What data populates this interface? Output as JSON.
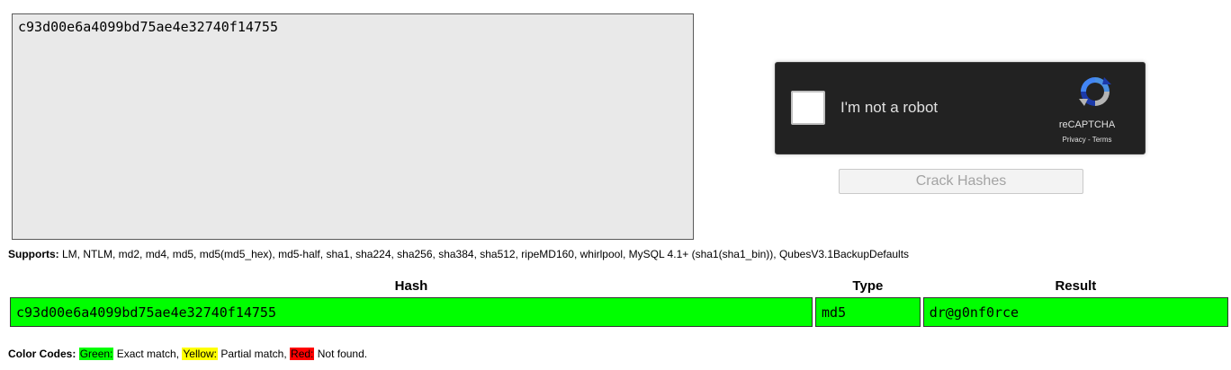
{
  "hash_input": {
    "value": "c93d00e6a4099bd75ae4e32740f14755"
  },
  "recaptcha": {
    "label": "I'm not a robot",
    "brand": "reCAPTCHA",
    "links": "Privacy - Terms"
  },
  "crack_button": {
    "label": "Crack Hashes"
  },
  "supports": {
    "label": "Supports:",
    "text": " LM, NTLM, md2, md4, md5, md5(md5_hex), md5-half, sha1, sha224, sha256, sha384, sha512, ripeMD160, whirlpool, MySQL 4.1+ (sha1(sha1_bin)), QubesV3.1BackupDefaults"
  },
  "results_table": {
    "headers": [
      "Hash",
      "Type",
      "Result"
    ],
    "rows": [
      {
        "hash": "c93d00e6a4099bd75ae4e32740f14755",
        "type": "md5",
        "result": "dr@g0nf0rce",
        "status": "exact"
      }
    ]
  },
  "color_codes": {
    "label": "Color Codes:",
    "green": {
      "name": "Green:",
      "desc": " Exact match, ",
      "color": "#00ff00"
    },
    "yellow": {
      "name": "Yellow:",
      "desc": " Partial match, ",
      "color": "#ffff00"
    },
    "red": {
      "name": "Red:",
      "desc": " Not found.",
      "color": "#ff0000"
    }
  }
}
